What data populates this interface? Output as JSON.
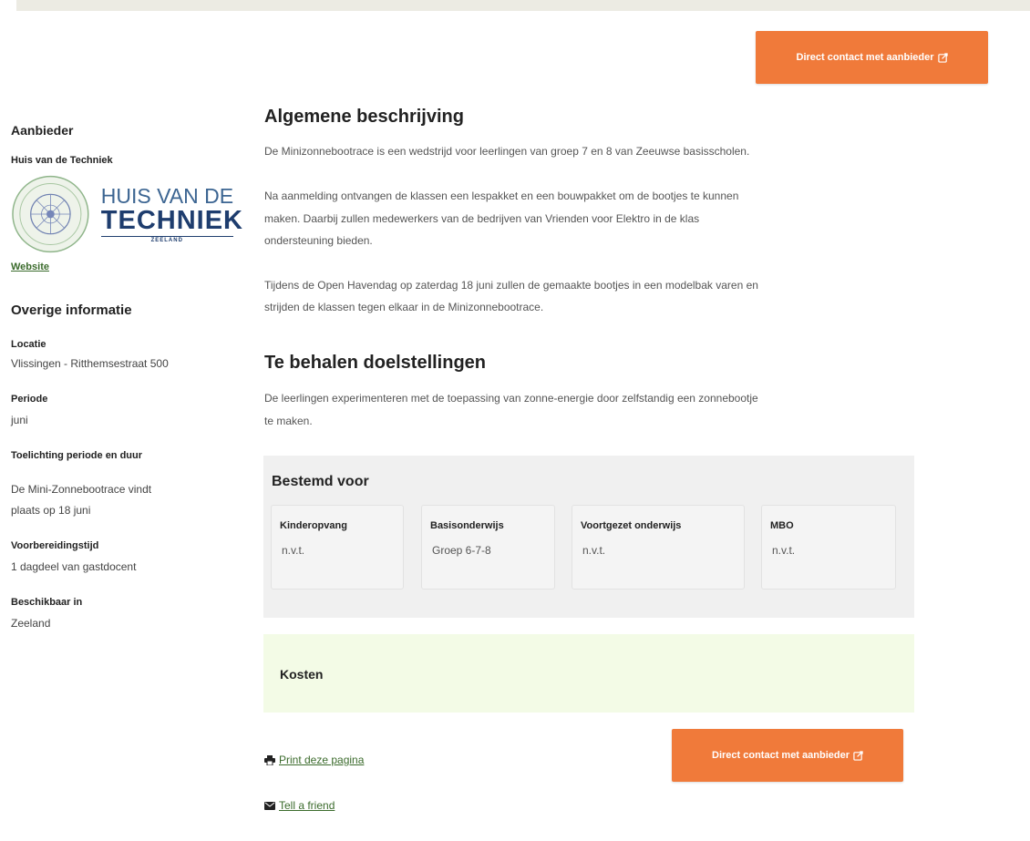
{
  "contact_button_label": "Direct contact met aanbieder",
  "sidebar": {
    "provider_heading": "Aanbieder",
    "provider_name": "Huis van de Techniek",
    "logo": {
      "line1": "HUIS VAN DE",
      "line2": "TECHNIEK",
      "line3": "ZEELAND"
    },
    "website_link": "Website",
    "other_info_heading": "Overige informatie",
    "location_label": "Locatie",
    "location_value": "Vlissingen - Ritthemsestraat 500",
    "period_label": "Periode",
    "period_value": "juni",
    "period_explanation_label": "Toelichting periode en duur",
    "period_explanation_line1": "De Mini-Zonnebootrace vindt",
    "period_explanation_line2": "plaats op 18 juni",
    "prep_label": "Voorbereidingstijd",
    "prep_value": "1 dagdeel van gastdocent",
    "available_label": "Beschikbaar in",
    "available_value": "Zeeland"
  },
  "main": {
    "description_heading": "Algemene beschrijving",
    "p1": "De Minizonnebootrace is een wedstrijd voor leerlingen van groep 7 en 8 van Zeeuwse basisscholen.",
    "p2_line1": "Na aanmelding ontvangen de klassen een lespakket en een bouwpakket om de bootjes te kunnen",
    "p2_line2": "maken. Daarbij zullen medewerkers van de bedrijven van Vrienden voor Elektro in de klas",
    "p2_line3": "ondersteuning bieden.",
    "p3_line1": "Tijdens de Open Havendag op zaterdag 18 juni zullen de gemaakte bootjes in een modelbak varen en",
    "p3_line2": "strijden de klassen tegen elkaar in de Minizonnebootrace.",
    "goals_heading": "Te behalen doelstellingen",
    "goals_line1": "De leerlingen experimenteren met de toepassing van zonne-energie door zelfstandig een zonnebootje",
    "goals_line2": "te maken.",
    "intended_heading": "Bestemd voor",
    "audience": [
      {
        "title": "Kinderopvang",
        "value": "n.v.t."
      },
      {
        "title": "Basisonderwijs",
        "value": "Groep 6-7-8"
      },
      {
        "title": "Voortgezet onderwijs",
        "value": "n.v.t."
      },
      {
        "title": "MBO",
        "value": "n.v.t."
      }
    ],
    "costs_heading": "Kosten",
    "print_link": "Print deze pagina",
    "tell_friend_link": "Tell a friend"
  },
  "colors": {
    "accent": "#f07a3a",
    "link": "#3b6b2c",
    "costs_bg": "#f3fbe6",
    "panel_bg": "#f0f0f0"
  },
  "icons": {
    "contact": "external-edit-icon",
    "print": "printer-icon",
    "mail": "envelope-icon"
  }
}
